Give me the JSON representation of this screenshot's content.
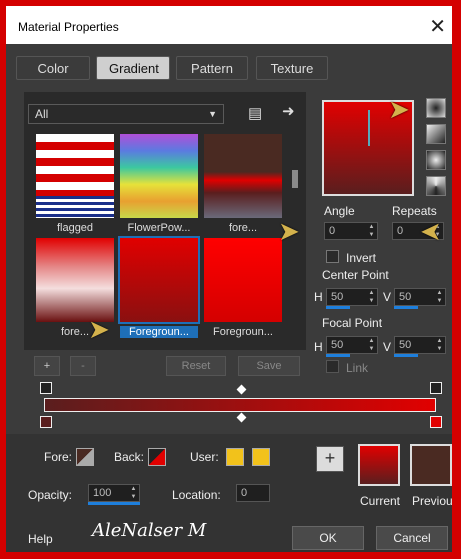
{
  "window": {
    "title": "Material Properties",
    "close": "✕"
  },
  "tabs": [
    "Color",
    "Gradient",
    "Pattern",
    "Texture"
  ],
  "gradient_browser": {
    "category": "All",
    "items": [
      {
        "label": "flagged"
      },
      {
        "label": "FlowerPow..."
      },
      {
        "label": "fore..."
      },
      {
        "label": "fore..."
      },
      {
        "label": "Foregroun..."
      },
      {
        "label": "Foregroun..."
      }
    ],
    "buttons": {
      "add": "+",
      "remove": "-",
      "reset": "Reset",
      "save": "Save"
    }
  },
  "controls": {
    "angle_label": "Angle",
    "angle": "0",
    "repeats_label": "Repeats",
    "repeats": "0",
    "invert_label": "Invert",
    "center_label": "Center Point",
    "center_h_label": "H",
    "center_h": "50",
    "center_v_label": "V",
    "center_v": "50",
    "focal_label": "Focal Point",
    "focal_h_label": "H",
    "focal_h": "50",
    "focal_v_label": "V",
    "focal_v": "50",
    "link_label": "Link"
  },
  "footer": {
    "fore_label": "Fore:",
    "back_label": "Back:",
    "user_label": "User:",
    "opacity_label": "Opacity:",
    "opacity": "100",
    "location_label": "Location:",
    "location": "0",
    "current_label": "Current",
    "previous_label": "Previou",
    "help": "Help",
    "ok": "OK",
    "cancel": "Cancel",
    "signature": "AleNalser M"
  },
  "colors": {
    "accent": "#1e6fb8",
    "red": "#e10000",
    "maroon": "#5a1e1e",
    "yellow": "#f2c21b"
  }
}
